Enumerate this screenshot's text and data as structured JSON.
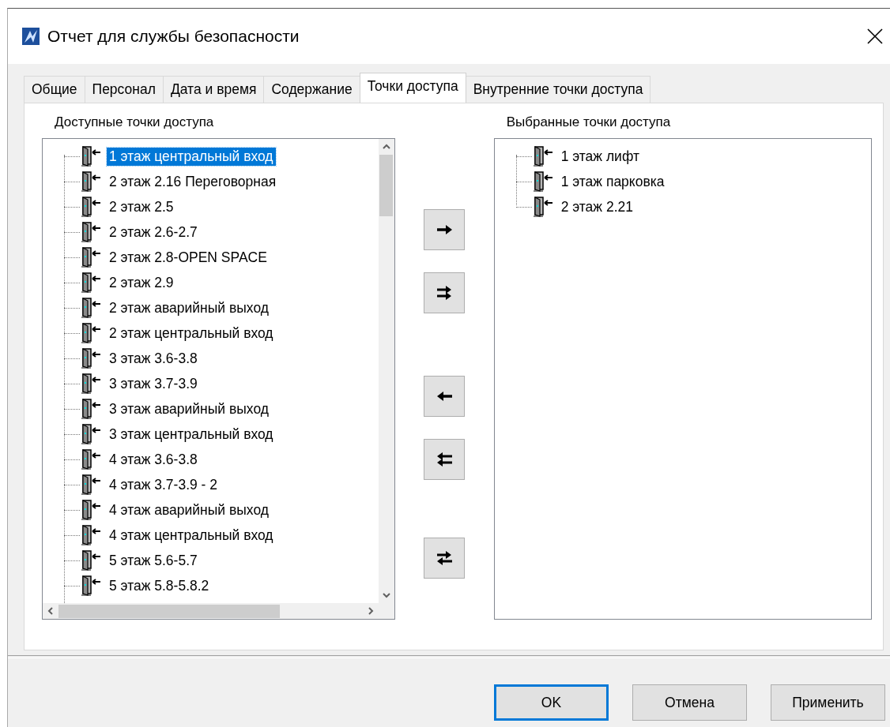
{
  "window": {
    "title": "Отчет для службы безопасности"
  },
  "tabs": [
    {
      "label": "Общие",
      "selected": false
    },
    {
      "label": "Персонал",
      "selected": false
    },
    {
      "label": "Дата и время",
      "selected": false
    },
    {
      "label": "Содержание",
      "selected": false
    },
    {
      "label": "Точки доступа",
      "selected": true
    },
    {
      "label": "Внутренние точки доступа",
      "selected": false
    }
  ],
  "available_points": {
    "label": "Доступные точки доступа",
    "items": [
      {
        "label": "1 этаж центральный вход",
        "selected": true
      },
      {
        "label": "2 этаж 2.16 Переговорная",
        "selected": false
      },
      {
        "label": "2 этаж 2.5",
        "selected": false
      },
      {
        "label": "2 этаж 2.6-2.7",
        "selected": false
      },
      {
        "label": "2 этаж 2.8-OPEN SPACE",
        "selected": false
      },
      {
        "label": "2 этаж 2.9",
        "selected": false
      },
      {
        "label": "2 этаж аварийный выход",
        "selected": false
      },
      {
        "label": "2 этаж центральный вход",
        "selected": false
      },
      {
        "label": "3 этаж 3.6-3.8",
        "selected": false
      },
      {
        "label": "3 этаж 3.7-3.9",
        "selected": false
      },
      {
        "label": "3 этаж аварийный выход",
        "selected": false
      },
      {
        "label": "3 этаж центральный вход",
        "selected": false
      },
      {
        "label": "4 этаж 3.6-3.8",
        "selected": false
      },
      {
        "label": "4 этаж 3.7-3.9 - 2",
        "selected": false
      },
      {
        "label": "4 этаж аварийный выход",
        "selected": false
      },
      {
        "label": "4 этаж центральный вход",
        "selected": false
      },
      {
        "label": "5 этаж 5.6-5.7",
        "selected": false
      },
      {
        "label": "5 этаж 5.8-5.8.2",
        "selected": false
      }
    ]
  },
  "transfer_buttons": [
    {
      "kind": "add"
    },
    {
      "kind": "add_all"
    },
    {
      "kind": "remove"
    },
    {
      "kind": "remove_all"
    },
    {
      "kind": "swap"
    }
  ],
  "selected_points": {
    "label": "Выбранные точки доступа",
    "items": [
      {
        "label": "1 этаж лифт",
        "selected": false
      },
      {
        "label": "1 этаж парковка",
        "selected": false
      },
      {
        "label": "2 этаж 2.21",
        "selected": false
      }
    ]
  },
  "buttons": [
    {
      "label": "OK",
      "default": true
    },
    {
      "label": "Отмена",
      "default": false
    },
    {
      "label": "Применить",
      "default": false
    }
  ]
}
